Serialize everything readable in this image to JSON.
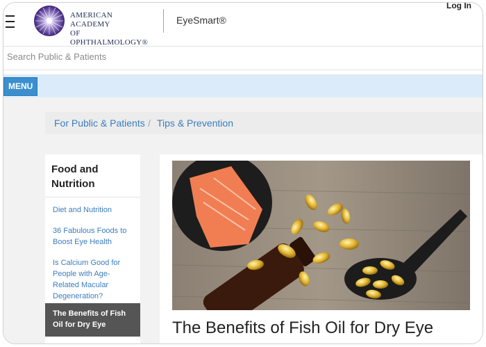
{
  "header": {
    "logo_line1": "AMERICAN ACADEMY",
    "logo_line2": "OF OPHTHALMOLOGY®",
    "brand": "EyeSmart®",
    "login": "Log In"
  },
  "search": {
    "placeholder": "Search Public & Patients"
  },
  "menu": {
    "label": "MENU"
  },
  "breadcrumb": {
    "item1": "For Public & Patients",
    "separator": "/",
    "item2": "Tips & Prevention"
  },
  "sidebar": {
    "title": "Food and Nutrition",
    "items": [
      {
        "label": "Diet and Nutrition"
      },
      {
        "label": "36 Fabulous Foods to Boost Eye Health"
      },
      {
        "label": "Is Calcium Good for People with Age-Related Macular Degeneration?"
      },
      {
        "label": "The Benefits of Fish Oil for Dry Eye"
      }
    ]
  },
  "article": {
    "title": "The Benefits of Fish Oil for Dry Eye"
  },
  "colors": {
    "link": "#3b7dbf",
    "menu_bg": "#dcebf9",
    "menu_button": "#3b8fcf",
    "active_item": "#555555",
    "logo_purple": "#4a2a8a"
  }
}
